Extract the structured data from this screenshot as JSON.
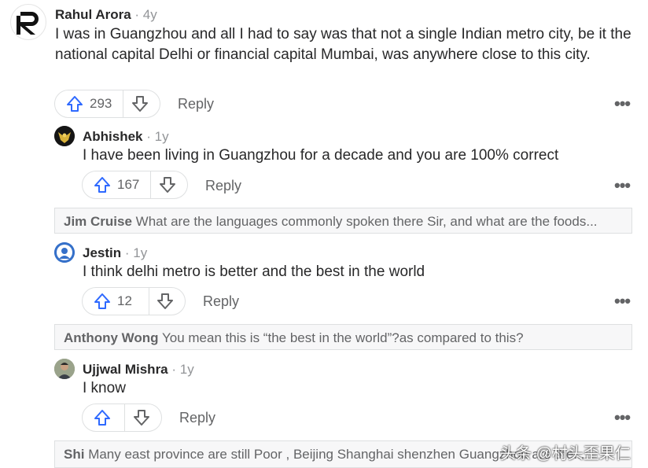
{
  "comments": [
    {
      "author": "Rahul Arora",
      "age": "4y",
      "text": "I was in Guangzhou and all I had to say was that not a single Indian metro city, be it the national capital Delhi or financial capital Mumbai, was anywhere close to this city.",
      "upvotes": "293",
      "reply": "Reply"
    },
    {
      "author": "Abhishek",
      "age": "1y",
      "text": "I have been living in Guangzhou for a decade and you are 100% correct",
      "upvotes": "167",
      "reply": "Reply"
    },
    {
      "author": "Jestin",
      "age": "1y",
      "text": "I think delhi metro is better and the best in the world",
      "upvotes": "12",
      "reply": "Reply"
    },
    {
      "author": "Ujjwal Mishra",
      "age": "1y",
      "text": "I know",
      "upvotes": "",
      "reply": "Reply"
    }
  ],
  "collapsed": [
    {
      "author": "Jim Cruise",
      "text": "What are the languages commonly spoken there Sir, and what are the foods..."
    },
    {
      "author": "Anthony Wong",
      "text": "You mean this is “the best in the world”?as compared to this?"
    },
    {
      "author": "Shi",
      "text": "Many east province are still Poor , Beijing Shanghai shenzhen Guangzhou are the..."
    }
  ],
  "watermark": "头条 @村头歪果仁",
  "icons": {
    "upvote": "arrow-up-icon",
    "downvote": "arrow-down-icon",
    "more": "more-dots-icon"
  },
  "colors": {
    "upvote_blue": "#2e69ff",
    "text": "#282829",
    "muted": "#939598"
  }
}
